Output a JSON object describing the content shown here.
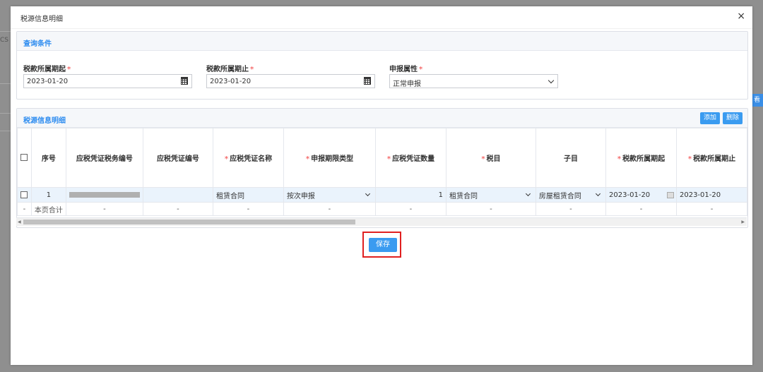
{
  "background": {
    "fragment": "CS",
    "right_button": "看"
  },
  "modal": {
    "title": "税源信息明细",
    "close_glyph": "×",
    "query": {
      "title": "查询条件",
      "start": {
        "label": "税款所属期起",
        "value": "2023-01-20"
      },
      "end": {
        "label": "税款所属期止",
        "value": "2023-01-20"
      },
      "attr": {
        "label": "申报属性",
        "value": "正常申报"
      },
      "required_mark": "*"
    },
    "detail": {
      "title": "税源信息明细",
      "add_label": "添加",
      "delete_label": "删除",
      "columns": {
        "seq": "序号",
        "tax_no": "应税凭证税务编号",
        "voucher_no": "应税凭证编号",
        "voucher_name": "应税凭证名称",
        "period_type": "申报期限类型",
        "quantity": "应税凭证数量",
        "item": "税目",
        "sub_item": "子目",
        "period_start": "税款所属期起",
        "period_end": "税款所属期止"
      },
      "row": {
        "seq": "1",
        "voucher_name": "租赁合同",
        "period_type": "按次申报",
        "quantity": "1",
        "item": "租赁合同",
        "sub_item": "房屋租赁合同",
        "period_start": "2023-01-20",
        "period_end": "2023-01-20"
      },
      "summary": {
        "dash": "-",
        "label": "本页合计"
      },
      "scroll_left": "◀",
      "scroll_right": "▶"
    },
    "save_label": "保存"
  },
  "colors": {
    "accent": "#3a9bf0",
    "required": "#f56c6c",
    "highlight_box": "#e02020",
    "row_selected": "#eaf3fc"
  }
}
